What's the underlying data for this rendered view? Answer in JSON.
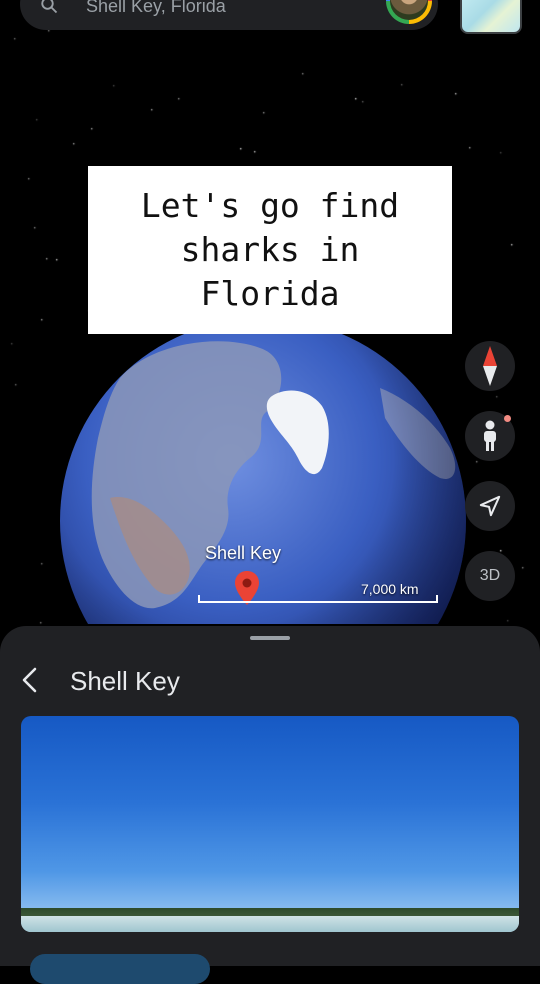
{
  "search": {
    "text": "Shell Key, Florida"
  },
  "caption": {
    "text": "Let's go find\nsharks in\nFlorida"
  },
  "map": {
    "place_label": "Shell Key",
    "scale_label": "7,000 km"
  },
  "controls": {
    "three_d_label": "3D"
  },
  "sheet": {
    "title": "Shell Key"
  },
  "colors": {
    "background": "#000000",
    "panel": "#202124",
    "pin": "#ea4335",
    "compass_north": "#ea4335"
  },
  "icons": [
    "search-icon",
    "avatar",
    "compass-icon",
    "pegman-icon",
    "locate-icon",
    "back-arrow-icon",
    "map-pin-icon"
  ]
}
